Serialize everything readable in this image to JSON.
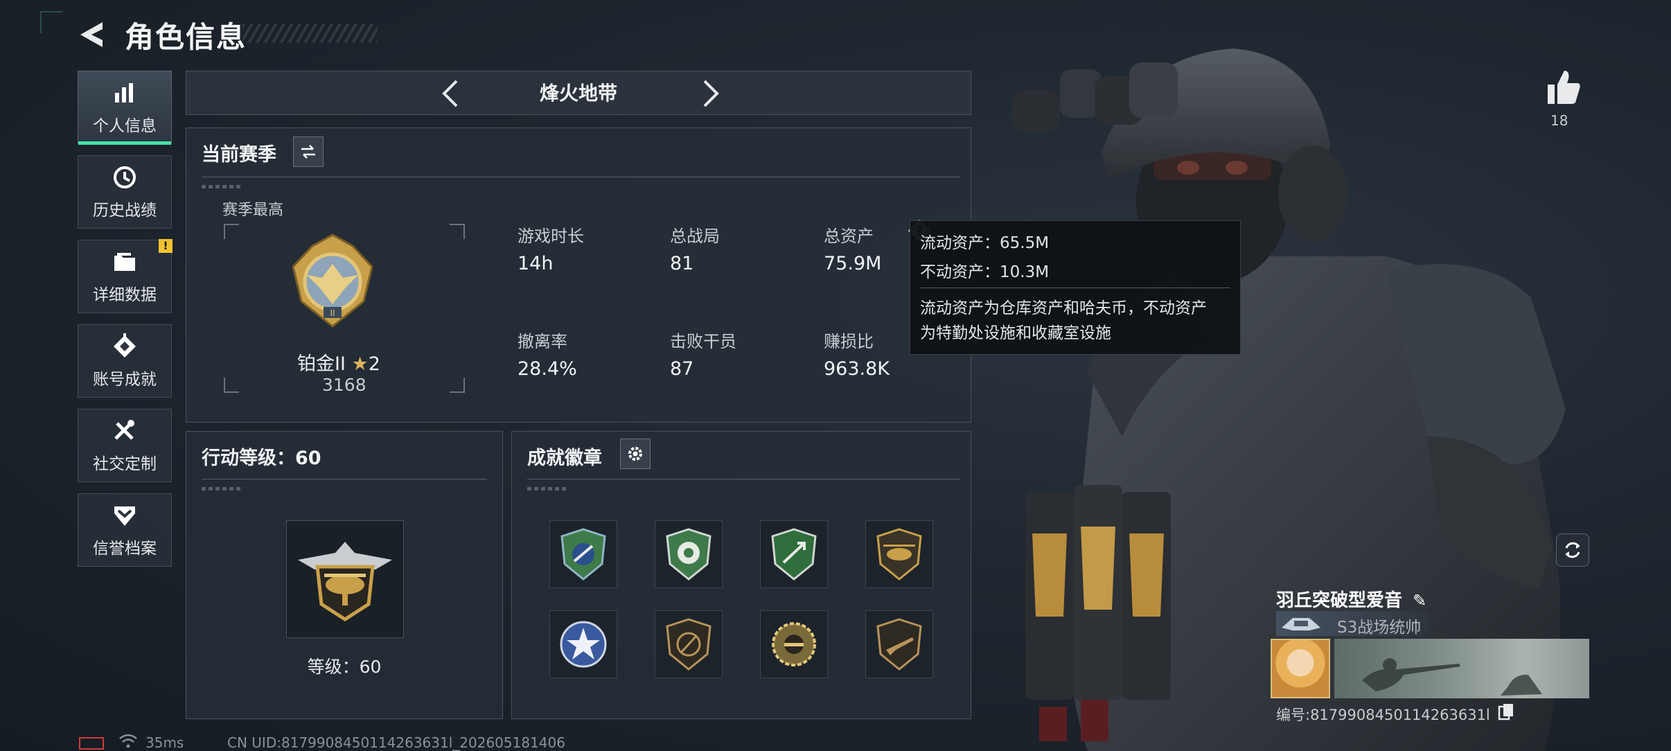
{
  "header": {
    "title": "角色信息"
  },
  "nav": {
    "items": [
      {
        "label": "个人信息",
        "icon": "bar-chart-icon",
        "active": true
      },
      {
        "label": "历史战绩",
        "icon": "history-clock-icon"
      },
      {
        "label": "详细数据",
        "icon": "folder-icon",
        "badge": "!"
      },
      {
        "label": "账号成就",
        "icon": "achievement-icon"
      },
      {
        "label": "社交定制",
        "icon": "tools-icon"
      },
      {
        "label": "信誉档案",
        "icon": "shield-chevron-icon"
      }
    ]
  },
  "mode": {
    "name": "烽火地带"
  },
  "season": {
    "title": "当前赛季",
    "best_label": "赛季最高",
    "rank_name": "铂金II",
    "rank_stars": "2",
    "rank_score": "3168",
    "stats": [
      {
        "label": "游戏时长",
        "value": "14h"
      },
      {
        "label": "总战局",
        "value": "81"
      },
      {
        "label": "总资产",
        "value": "75.9M"
      },
      {
        "label": "撤离率",
        "value": "28.4%"
      },
      {
        "label": "击败干员",
        "value": "87"
      },
      {
        "label": "赚损比",
        "value": "963.8K"
      }
    ]
  },
  "tooltip": {
    "line1": "流动资产：65.5M",
    "line2": "不动资产：10.3M",
    "desc1": "流动资产为仓库资产和哈夫币，不动资产",
    "desc2": "为特勤处设施和收藏室设施"
  },
  "action_level": {
    "title": "行动等级：60",
    "level_text": "等级：60"
  },
  "achievements": {
    "title": "成就徽章",
    "badges": [
      "green-shield-badge-icon",
      "green-flower-badge-icon",
      "green-arrows-badge-icon",
      "helicopter-badge-icon",
      "blue-star-badge-icon",
      "bronze-shield-badge-icon",
      "gold-sunburst-badge-icon",
      "bronze-rifle-badge-icon"
    ]
  },
  "profile": {
    "likes": "18",
    "name": "羽丘突破型爱音",
    "title": "S3战场统帅",
    "id_text": "编号:8179908450114263631l"
  },
  "status_bar": {
    "ping": "35ms",
    "uid": "CN UID:8179908450114263631l_202605181406"
  },
  "colors": {
    "accent": "#45e0a7",
    "badge": "#f2c230",
    "gold": "#c9a04a"
  }
}
